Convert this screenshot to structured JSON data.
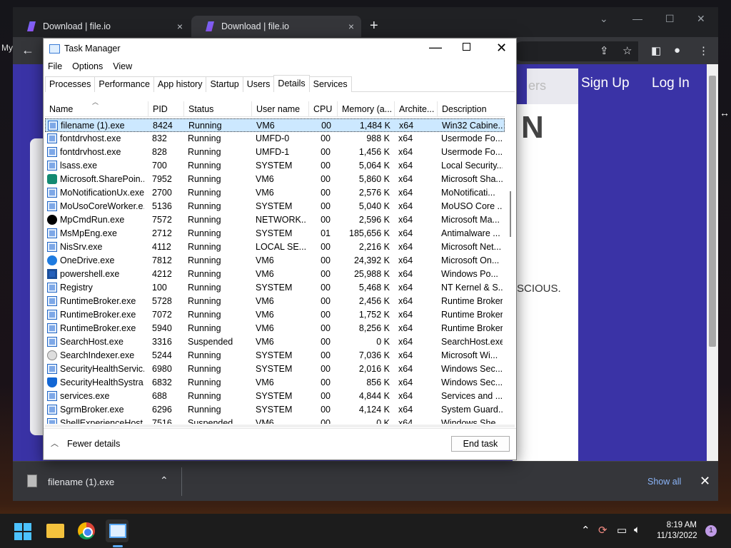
{
  "desktop": {
    "partial_label": "My"
  },
  "chrome": {
    "tabs": [
      {
        "label": "Download | file.io"
      },
      {
        "label": "Download | file.io"
      }
    ],
    "close_glyph": "×",
    "newtab_glyph": "+",
    "page": {
      "signup": "Sign Up",
      "login": "Log In",
      "ad_fragment": "ers",
      "big_letter": "N",
      "text_fragment": "SCIOUS."
    },
    "downloads": {
      "filename": "filename (1).exe",
      "show_all": "Show all"
    }
  },
  "taskmanager": {
    "title": "Task Manager",
    "menu": [
      "File",
      "Options",
      "View"
    ],
    "tabs": [
      "Processes",
      "Performance",
      "App history",
      "Startup",
      "Users",
      "Details",
      "Services"
    ],
    "active_tab": "Details",
    "columns": [
      "Name",
      "PID",
      "Status",
      "User name",
      "CPU",
      "Memory (a...",
      "Archite...",
      "Description"
    ],
    "rows": [
      {
        "name": "filename (1).exe",
        "pid": "8424",
        "status": "Running",
        "user": "VM6",
        "cpu": "00",
        "mem": "1,484 K",
        "arch": "x64",
        "desc": "Win32 Cabine...",
        "icon": "app",
        "selected": true
      },
      {
        "name": "fontdrvhost.exe",
        "pid": "832",
        "status": "Running",
        "user": "UMFD-0",
        "cpu": "00",
        "mem": "988 K",
        "arch": "x64",
        "desc": "Usermode Fo...",
        "icon": "app"
      },
      {
        "name": "fontdrvhost.exe",
        "pid": "828",
        "status": "Running",
        "user": "UMFD-1",
        "cpu": "00",
        "mem": "1,456 K",
        "arch": "x64",
        "desc": "Usermode Fo...",
        "icon": "app"
      },
      {
        "name": "lsass.exe",
        "pid": "700",
        "status": "Running",
        "user": "SYSTEM",
        "cpu": "00",
        "mem": "5,064 K",
        "arch": "x64",
        "desc": "Local Security...",
        "icon": "app"
      },
      {
        "name": "Microsoft.SharePoin...",
        "pid": "7952",
        "status": "Running",
        "user": "VM6",
        "cpu": "00",
        "mem": "5,860 K",
        "arch": "x64",
        "desc": "Microsoft Sha...",
        "icon": "green"
      },
      {
        "name": "MoNotificationUx.exe",
        "pid": "2700",
        "status": "Running",
        "user": "VM6",
        "cpu": "00",
        "mem": "2,576 K",
        "arch": "x64",
        "desc": "MoNotificati...",
        "icon": "app"
      },
      {
        "name": "MoUsoCoreWorker.e...",
        "pid": "5136",
        "status": "Running",
        "user": "SYSTEM",
        "cpu": "00",
        "mem": "5,040 K",
        "arch": "x64",
        "desc": "MoUSO Core ...",
        "icon": "app"
      },
      {
        "name": "MpCmdRun.exe",
        "pid": "7572",
        "status": "Running",
        "user": "NETWORK...",
        "cpu": "00",
        "mem": "2,596 K",
        "arch": "x64",
        "desc": "Microsoft Ma...",
        "icon": "dark"
      },
      {
        "name": "MsMpEng.exe",
        "pid": "2712",
        "status": "Running",
        "user": "SYSTEM",
        "cpu": "01",
        "mem": "185,656 K",
        "arch": "x64",
        "desc": "Antimalware ...",
        "icon": "app"
      },
      {
        "name": "NisSrv.exe",
        "pid": "4112",
        "status": "Running",
        "user": "LOCAL SE...",
        "cpu": "00",
        "mem": "2,216 K",
        "arch": "x64",
        "desc": "Microsoft Net...",
        "icon": "app"
      },
      {
        "name": "OneDrive.exe",
        "pid": "7812",
        "status": "Running",
        "user": "VM6",
        "cpu": "00",
        "mem": "24,392 K",
        "arch": "x64",
        "desc": "Microsoft On...",
        "icon": "round"
      },
      {
        "name": "powershell.exe",
        "pid": "4212",
        "status": "Running",
        "user": "VM6",
        "cpu": "00",
        "mem": "25,988 K",
        "arch": "x64",
        "desc": "Windows Po...",
        "icon": "ps"
      },
      {
        "name": "Registry",
        "pid": "100",
        "status": "Running",
        "user": "SYSTEM",
        "cpu": "00",
        "mem": "5,468 K",
        "arch": "x64",
        "desc": "NT Kernel & S...",
        "icon": "app"
      },
      {
        "name": "RuntimeBroker.exe",
        "pid": "5728",
        "status": "Running",
        "user": "VM6",
        "cpu": "00",
        "mem": "2,456 K",
        "arch": "x64",
        "desc": "Runtime Broker",
        "icon": "app"
      },
      {
        "name": "RuntimeBroker.exe",
        "pid": "7072",
        "status": "Running",
        "user": "VM6",
        "cpu": "00",
        "mem": "1,752 K",
        "arch": "x64",
        "desc": "Runtime Broker",
        "icon": "app"
      },
      {
        "name": "RuntimeBroker.exe",
        "pid": "5940",
        "status": "Running",
        "user": "VM6",
        "cpu": "00",
        "mem": "8,256 K",
        "arch": "x64",
        "desc": "Runtime Broker",
        "icon": "app"
      },
      {
        "name": "SearchHost.exe",
        "pid": "3316",
        "status": "Suspended",
        "user": "VM6",
        "cpu": "00",
        "mem": "0 K",
        "arch": "x64",
        "desc": "SearchHost.exe",
        "icon": "app"
      },
      {
        "name": "SearchIndexer.exe",
        "pid": "5244",
        "status": "Running",
        "user": "SYSTEM",
        "cpu": "00",
        "mem": "7,036 K",
        "arch": "x64",
        "desc": "Microsoft Wi...",
        "icon": "search"
      },
      {
        "name": "SecurityHealthServic...",
        "pid": "6980",
        "status": "Running",
        "user": "SYSTEM",
        "cpu": "00",
        "mem": "2,016 K",
        "arch": "x64",
        "desc": "Windows Sec...",
        "icon": "app"
      },
      {
        "name": "SecurityHealthSystra...",
        "pid": "6832",
        "status": "Running",
        "user": "VM6",
        "cpu": "00",
        "mem": "856 K",
        "arch": "x64",
        "desc": "Windows Sec...",
        "icon": "shield"
      },
      {
        "name": "services.exe",
        "pid": "688",
        "status": "Running",
        "user": "SYSTEM",
        "cpu": "00",
        "mem": "4,844 K",
        "arch": "x64",
        "desc": "Services and ...",
        "icon": "app"
      },
      {
        "name": "SgrmBroker.exe",
        "pid": "6296",
        "status": "Running",
        "user": "SYSTEM",
        "cpu": "00",
        "mem": "4,124 K",
        "arch": "x64",
        "desc": "System Guard...",
        "icon": "app"
      },
      {
        "name": "ShellExperienceHost...",
        "pid": "7516",
        "status": "Suspended",
        "user": "VM6",
        "cpu": "00",
        "mem": "0 K",
        "arch": "x64",
        "desc": "Windows She...",
        "icon": "app"
      }
    ],
    "footer": {
      "fewer_details": "Fewer details",
      "end_task": "End task"
    }
  },
  "taskbar": {
    "time": "8:19 AM",
    "date": "11/13/2022",
    "notification_count": "1"
  }
}
